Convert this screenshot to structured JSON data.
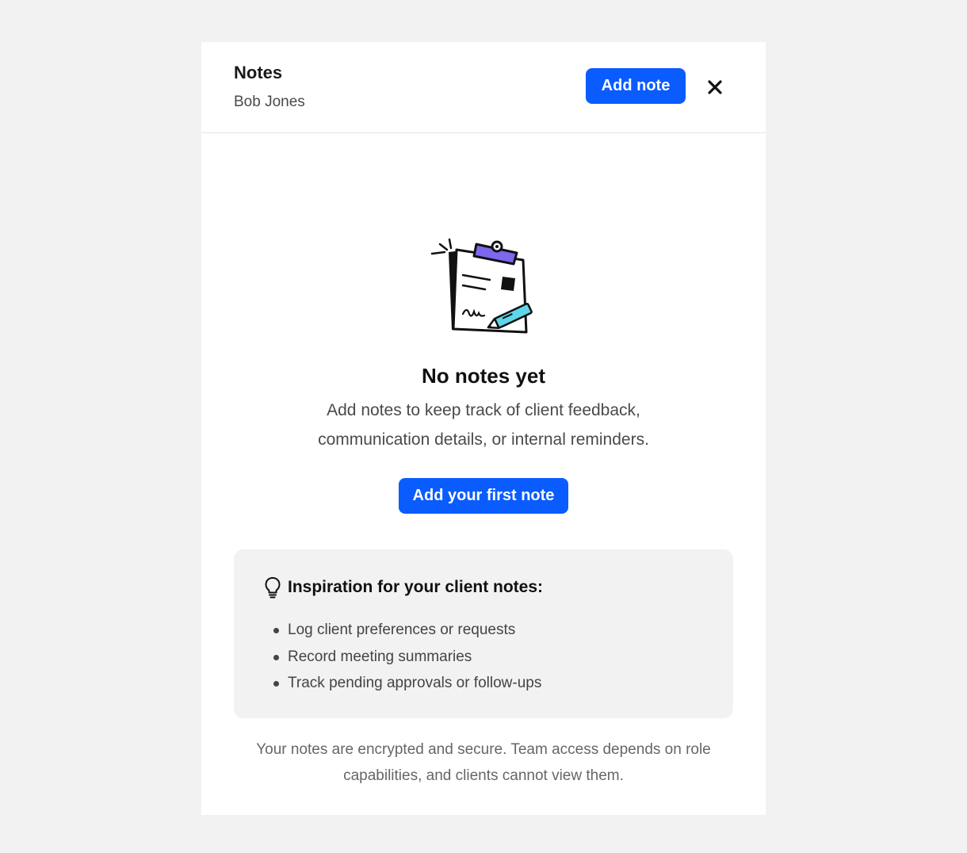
{
  "header": {
    "title": "Notes",
    "subtitle": "Bob Jones",
    "add_note_label": "Add note",
    "close_icon": "close-icon"
  },
  "empty_state": {
    "illustration": "clipboard-pencil-illustration",
    "title": "No notes yet",
    "description": "Add notes to keep track of client feedback, communication details, or internal reminders.",
    "cta_label": "Add your first note"
  },
  "inspiration": {
    "icon": "lightbulb-icon",
    "title": "Inspiration for your client notes:",
    "items": [
      "Log client preferences or requests",
      "Record meeting summaries",
      "Track pending approvals or follow-ups"
    ]
  },
  "footer": {
    "text": "Your notes are encrypted and secure. Team access depends on role capabilities, and clients cannot view them."
  },
  "colors": {
    "accent": "#0a5cff",
    "background": "#f2f2f2",
    "panel": "#ffffff",
    "clip": "#7b68ee",
    "pencil": "#5dd6e8"
  }
}
